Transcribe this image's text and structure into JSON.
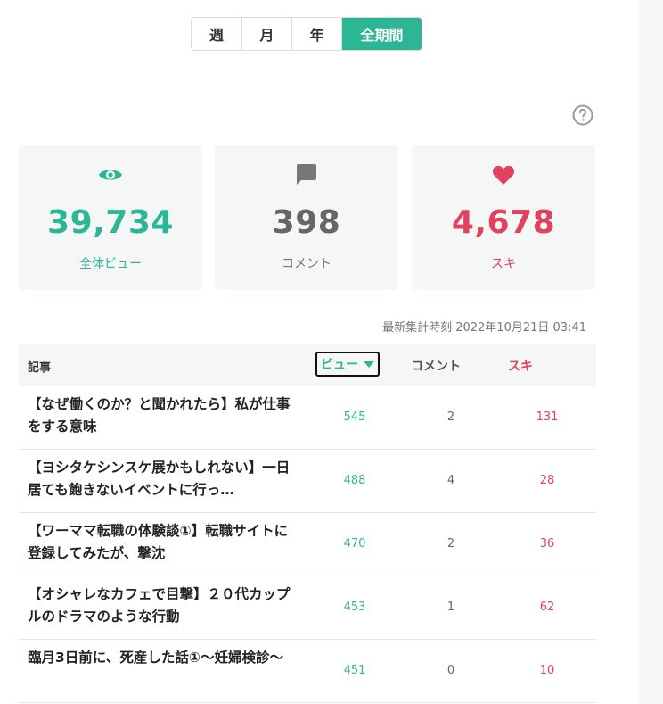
{
  "period_tabs": [
    {
      "label": "週",
      "active": false
    },
    {
      "label": "月",
      "active": false
    },
    {
      "label": "年",
      "active": false
    },
    {
      "label": "全期間",
      "active": true
    }
  ],
  "help_icon": "question-circle-icon",
  "stats": {
    "views": {
      "value": "39,734",
      "label": "全体ビュー",
      "icon": "eye-icon",
      "color": "#2cb696"
    },
    "comments": {
      "value": "398",
      "label": "コメント",
      "icon": "comment-icon",
      "color": "#666666"
    },
    "likes": {
      "value": "4,678",
      "label": "スキ",
      "icon": "heart-icon",
      "color": "#e0435d"
    }
  },
  "updated_at": "最新集計時刻 2022年10月21日 03:41",
  "table": {
    "headers": {
      "title": "記事",
      "views": "ビュー",
      "comments": "コメント",
      "likes": "スキ"
    },
    "sort_icon": "sort-down-icon",
    "rows": [
      {
        "title": "【なぜ働くのか？と聞かれたら】私が仕事をする意味",
        "views": "545",
        "comments": "2",
        "likes": "131"
      },
      {
        "title": "【ヨシタケシンスケ展かもしれない】一日居ても飽きないイベントに行っ…",
        "views": "488",
        "comments": "4",
        "likes": "28"
      },
      {
        "title": "【ワーママ転職の体験談①】転職サイトに登録してみたが、撃沈",
        "views": "470",
        "comments": "2",
        "likes": "36"
      },
      {
        "title": "【オシャレなカフェで目撃】２０代カップルのドラマのような行動",
        "views": "453",
        "comments": "1",
        "likes": "62"
      },
      {
        "title": "臨月3日前に、死産した話①〜妊婦検診〜",
        "views": "451",
        "comments": "0",
        "likes": "10"
      }
    ]
  }
}
